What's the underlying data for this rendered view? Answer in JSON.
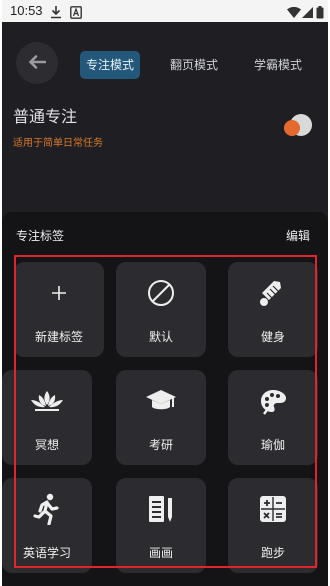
{
  "status_bar": {
    "time": "10:53"
  },
  "mode_tabs": [
    {
      "label": "专注模式",
      "active": true
    },
    {
      "label": "翻页模式",
      "active": false
    },
    {
      "label": "学霸模式",
      "active": false
    }
  ],
  "mode": {
    "title": "普通专注",
    "subtitle": "适用于简单日常任务"
  },
  "sheet": {
    "title": "专注标签",
    "edit_label": "编辑",
    "tags": [
      {
        "label": "新建标签",
        "icon": "plus-icon"
      },
      {
        "label": "默认",
        "icon": "prohibited-icon"
      },
      {
        "label": "健身",
        "icon": "shuttlecock-icon"
      },
      {
        "label": "冥想",
        "icon": "lotus-icon"
      },
      {
        "label": "考研",
        "icon": "graduation-cap-icon"
      },
      {
        "label": "瑜伽",
        "icon": "palette-icon"
      },
      {
        "label": "英语学习",
        "icon": "running-person-icon"
      },
      {
        "label": "画画",
        "icon": "notebook-pencil-icon"
      },
      {
        "label": "跑步",
        "icon": "calculator-icon"
      }
    ]
  },
  "colors": {
    "accent": "#24587a",
    "subtitle": "#d87a2a",
    "highlight": "#e0262c"
  }
}
